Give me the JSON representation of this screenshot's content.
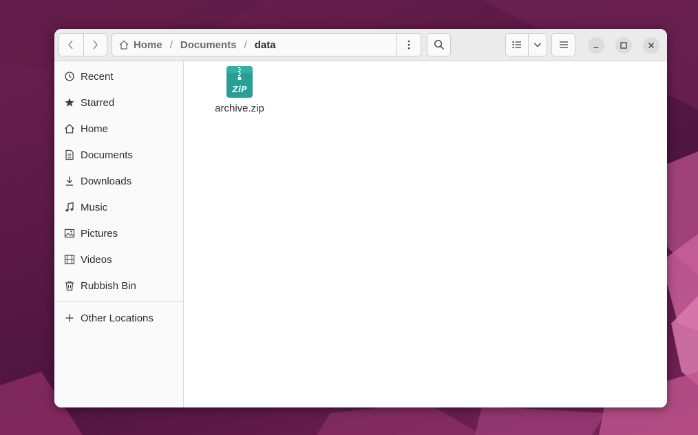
{
  "window": {
    "path": {
      "segments": [
        "Home",
        "Documents",
        "data"
      ],
      "separator": "/"
    }
  },
  "toolbar": {
    "back_icon": "chevron-left-icon",
    "forward_icon": "chevron-right-icon",
    "path_menu_icon": "vertical-dots-icon",
    "search_icon": "search-icon",
    "view_list_icon": "list-view-icon",
    "view_options_icon": "chevron-down-icon",
    "main_menu_icon": "hamburger-menu-icon",
    "minimize_icon": "minimize-icon",
    "maximize_icon": "maximize-icon",
    "close_icon": "close-icon"
  },
  "sidebar": {
    "items": [
      {
        "label": "Recent",
        "icon": "clock-icon"
      },
      {
        "label": "Starred",
        "icon": "star-icon"
      },
      {
        "label": "Home",
        "icon": "home-icon"
      },
      {
        "label": "Documents",
        "icon": "document-icon"
      },
      {
        "label": "Downloads",
        "icon": "download-icon"
      },
      {
        "label": "Music",
        "icon": "music-note-icon"
      },
      {
        "label": "Pictures",
        "icon": "picture-icon"
      },
      {
        "label": "Videos",
        "icon": "film-icon"
      },
      {
        "label": "Rubbish Bin",
        "icon": "trash-icon"
      }
    ],
    "other": {
      "label": "Other Locations",
      "icon": "plus-icon"
    }
  },
  "files": [
    {
      "name": "archive.zip",
      "icon": "zip-archive-icon",
      "icon_text": "ZiP"
    }
  ],
  "colors": {
    "zip_icon": "#2a9d96",
    "desktop": "#5a1843"
  }
}
